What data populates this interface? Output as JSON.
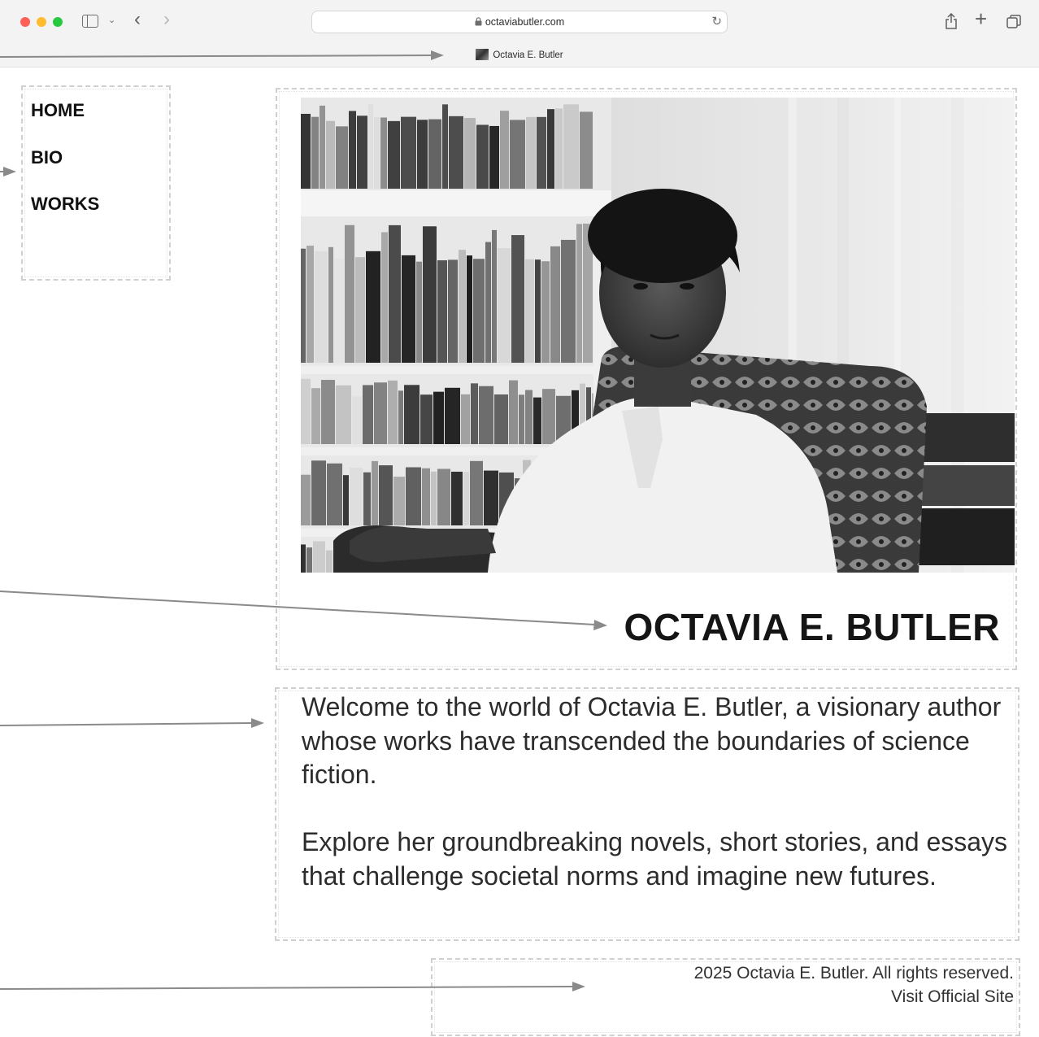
{
  "browser": {
    "url": "octaviabutler.com",
    "tab_title": "Octavia E. Butler"
  },
  "nav": {
    "items": [
      "HOME",
      "BIO",
      "WORKS"
    ]
  },
  "hero": {
    "title": "OCTAVIA E. BUTLER",
    "photo_alt": "Octavia E. Butler seated in an armchair in front of bookshelves"
  },
  "intro": {
    "paragraphs": [
      "Welcome to the world of Octavia E. Butler, a visionary author whose works have transcended the boundaries of science fiction.",
      "Explore her groundbreaking novels, short stories, and essays that challenge societal norms and imagine new futures."
    ]
  },
  "footer": {
    "copyright": "2025 Octavia E. Butler. All rights reserved.",
    "official_link": "Visit Official Site"
  }
}
